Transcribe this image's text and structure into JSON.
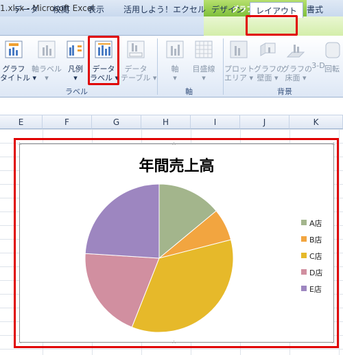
{
  "window": {
    "title": "1.xlsx  -  Microsoft Excel"
  },
  "tool_group": {
    "title": "グラフ ツール",
    "color": "#7fbf3a"
  },
  "tabs": [
    {
      "label": "データ"
    },
    {
      "label": "校閲"
    },
    {
      "label": "表示"
    },
    {
      "label": "活用しよう！エクセル"
    },
    {
      "label": "デザイン"
    },
    {
      "label": "レイアウト"
    },
    {
      "label": "書式"
    }
  ],
  "ribbon": {
    "buttons": [
      {
        "label": "グラフ\nタイトル ▾",
        "enabled": true
      },
      {
        "label": "軸ラベル\n▾",
        "enabled": false
      },
      {
        "label": "凡例\n▾",
        "enabled": true
      },
      {
        "label": "データ\nラベル ▾",
        "enabled": true
      },
      {
        "label": "データ\nテーブル ▾",
        "enabled": false
      },
      {
        "label": "軸\n▾",
        "enabled": false
      },
      {
        "label": "目盛線\n▾",
        "enabled": false
      },
      {
        "label": "プロット\nエリア ▾",
        "enabled": false
      },
      {
        "label": "グラフの\n壁面 ▾",
        "enabled": false
      },
      {
        "label": "グラフの\n床面 ▾",
        "enabled": false
      },
      {
        "label": "3-D",
        "enabled": false
      },
      {
        "label": "回転",
        "enabled": false
      }
    ],
    "groups": [
      {
        "label": "ラベル"
      },
      {
        "label": "軸"
      },
      {
        "label": "背景"
      }
    ]
  },
  "columns": [
    "E",
    "F",
    "G",
    "H",
    "I",
    "J",
    "K"
  ],
  "accent": "#e00000",
  "chart_data": {
    "type": "pie",
    "title": "年間売上高",
    "categories": [
      "A店",
      "B店",
      "C店",
      "D店",
      "E店"
    ],
    "values": [
      14,
      7,
      35,
      20,
      24
    ],
    "colors": [
      "#a3b58c",
      "#f2a540",
      "#e6b92a",
      "#d18fa0",
      "#9d86c0"
    ],
    "legend": "right"
  }
}
